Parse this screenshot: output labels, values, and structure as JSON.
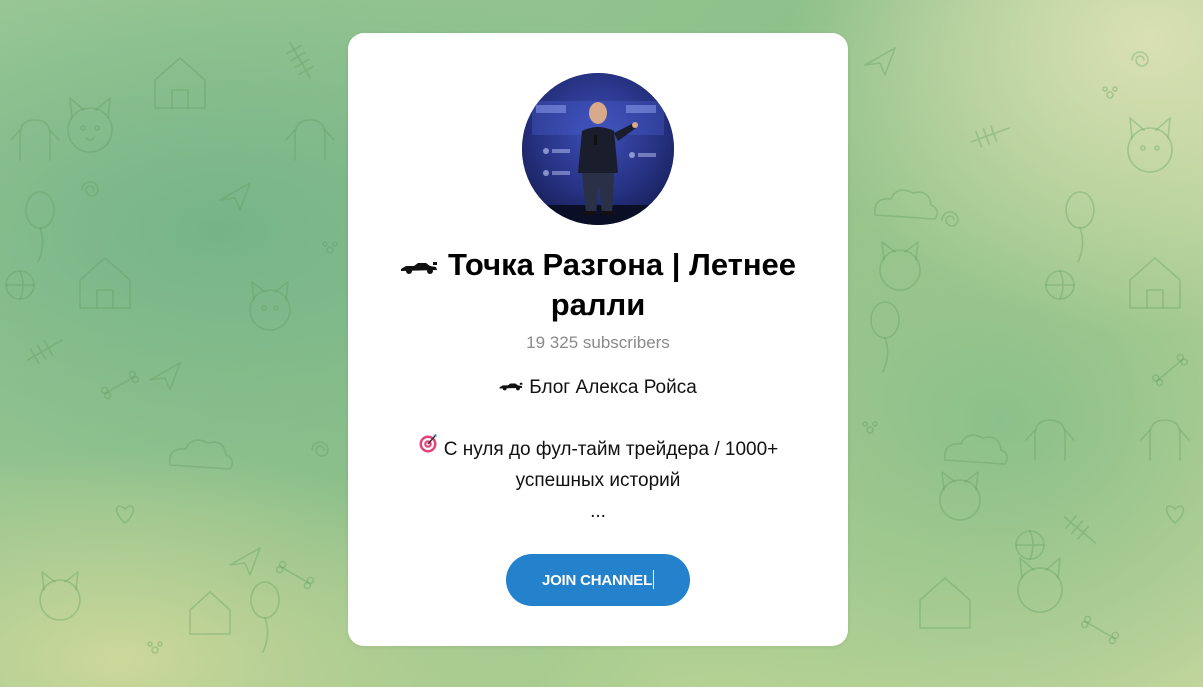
{
  "channel": {
    "title": "Точка Разгона | Летнее ралли",
    "title_icon": "race-car-icon",
    "subscribers": "19 325 subscribers",
    "description": {
      "line1_icon": "race-car-icon",
      "line1": "Блог Алекса Ройса",
      "line2_icon": "target-icon",
      "line2": "С нуля до фул-тайм трейдера / 1000+ успешных историй",
      "ellipsis": "..."
    }
  },
  "actions": {
    "join_label": "JOIN CHANNEL"
  },
  "colors": {
    "accent": "#2481cc",
    "card": "#ffffff",
    "subscribers_text": "#8a8a8a"
  }
}
